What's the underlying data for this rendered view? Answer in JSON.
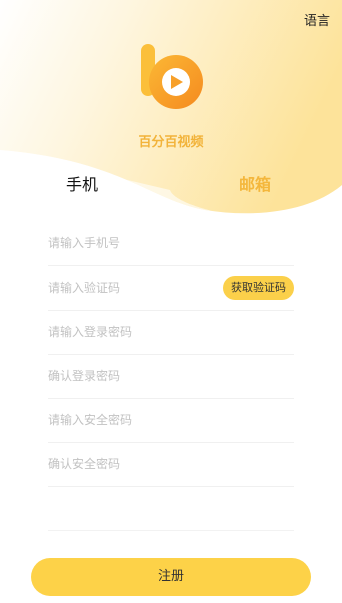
{
  "header": {
    "language_label": "语言",
    "app_name": "百分百视频"
  },
  "tabs": [
    {
      "label": "手机",
      "active": true
    },
    {
      "label": "邮箱",
      "active": false
    }
  ],
  "form": {
    "phone_placeholder": "请输入手机号",
    "code_placeholder": "请输入验证码",
    "get_code_label": "获取验证码",
    "login_password_placeholder": "请输入登录密码",
    "confirm_login_password_placeholder": "确认登录密码",
    "safe_password_placeholder": "请输入安全密码",
    "confirm_safe_password_placeholder": "确认安全密码"
  },
  "submit": {
    "label": "注册"
  },
  "colors": {
    "accent": "#fdd248",
    "brand_text": "#f2b33a",
    "gradient_start": "#fdf2d6",
    "gradient_end": "#fde7a6"
  },
  "icons": {
    "logo": "video-play-b-logo-icon"
  }
}
